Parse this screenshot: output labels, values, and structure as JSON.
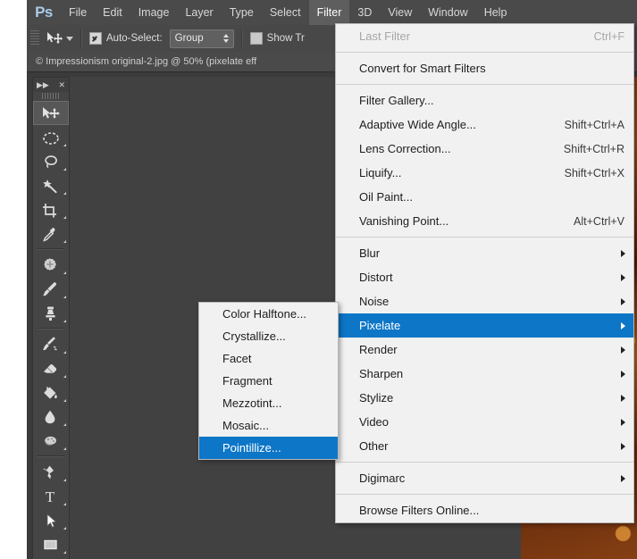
{
  "app": {
    "name": "Adobe Photoshop",
    "logo_text": "Ps"
  },
  "menubar": {
    "items": [
      {
        "label": "File",
        "active": false
      },
      {
        "label": "Edit",
        "active": false
      },
      {
        "label": "Image",
        "active": false
      },
      {
        "label": "Layer",
        "active": false
      },
      {
        "label": "Type",
        "active": false
      },
      {
        "label": "Select",
        "active": false
      },
      {
        "label": "Filter",
        "active": true
      },
      {
        "label": "3D",
        "active": false
      },
      {
        "label": "View",
        "active": false
      },
      {
        "label": "Window",
        "active": false
      },
      {
        "label": "Help",
        "active": false
      }
    ]
  },
  "options_bar": {
    "tool": "move-tool",
    "auto_select_label": "Auto-Select:",
    "auto_select_checked": true,
    "auto_select_value": "Group",
    "show_transform_label": "Show Tr",
    "show_transform_checked": false,
    "align_icon": "align-vertical-center-icon"
  },
  "document": {
    "tab_title": "© Impressionism original-2.jpg @ 50% (pixelate eff"
  },
  "toolbar": {
    "collapse_icon": "expand-arrows-icon",
    "close_icon": "close-icon",
    "tools": [
      {
        "name": "move-tool",
        "selected": true
      },
      {
        "name": "marquee-tool",
        "selected": false
      },
      {
        "name": "lasso-tool",
        "selected": false
      },
      {
        "name": "magic-wand-tool",
        "selected": false
      },
      {
        "name": "crop-tool",
        "selected": false
      },
      {
        "name": "eyedropper-tool",
        "selected": false
      },
      {
        "name": "spot-healing-brush-tool",
        "selected": false
      },
      {
        "name": "brush-tool",
        "selected": false
      },
      {
        "name": "clone-stamp-tool",
        "selected": false
      },
      {
        "name": "history-brush-tool",
        "selected": false
      },
      {
        "name": "eraser-tool",
        "selected": false
      },
      {
        "name": "paint-bucket-tool",
        "selected": false
      },
      {
        "name": "blur-tool",
        "selected": false
      },
      {
        "name": "dodge-tool",
        "selected": false
      },
      {
        "name": "pen-tool",
        "selected": false
      },
      {
        "name": "type-tool",
        "selected": false
      },
      {
        "name": "path-selection-tool",
        "selected": false
      },
      {
        "name": "rectangle-shape-tool",
        "selected": false
      }
    ]
  },
  "filter_menu": {
    "groups": [
      [
        {
          "label": "Last Filter",
          "shortcut": "Ctrl+F",
          "disabled": true,
          "submenu": false,
          "highlighted": false
        }
      ],
      [
        {
          "label": "Convert for Smart Filters",
          "shortcut": "",
          "disabled": false,
          "submenu": false,
          "highlighted": false
        }
      ],
      [
        {
          "label": "Filter Gallery...",
          "shortcut": "",
          "disabled": false,
          "submenu": false,
          "highlighted": false
        },
        {
          "label": "Adaptive Wide Angle...",
          "shortcut": "Shift+Ctrl+A",
          "disabled": false,
          "submenu": false,
          "highlighted": false
        },
        {
          "label": "Lens Correction...",
          "shortcut": "Shift+Ctrl+R",
          "disabled": false,
          "submenu": false,
          "highlighted": false
        },
        {
          "label": "Liquify...",
          "shortcut": "Shift+Ctrl+X",
          "disabled": false,
          "submenu": false,
          "highlighted": false
        },
        {
          "label": "Oil Paint...",
          "shortcut": "",
          "disabled": false,
          "submenu": false,
          "highlighted": false
        },
        {
          "label": "Vanishing Point...",
          "shortcut": "Alt+Ctrl+V",
          "disabled": false,
          "submenu": false,
          "highlighted": false
        }
      ],
      [
        {
          "label": "Blur",
          "shortcut": "",
          "disabled": false,
          "submenu": true,
          "highlighted": false
        },
        {
          "label": "Distort",
          "shortcut": "",
          "disabled": false,
          "submenu": true,
          "highlighted": false
        },
        {
          "label": "Noise",
          "shortcut": "",
          "disabled": false,
          "submenu": true,
          "highlighted": false
        },
        {
          "label": "Pixelate",
          "shortcut": "",
          "disabled": false,
          "submenu": true,
          "highlighted": true
        },
        {
          "label": "Render",
          "shortcut": "",
          "disabled": false,
          "submenu": true,
          "highlighted": false
        },
        {
          "label": "Sharpen",
          "shortcut": "",
          "disabled": false,
          "submenu": true,
          "highlighted": false
        },
        {
          "label": "Stylize",
          "shortcut": "",
          "disabled": false,
          "submenu": true,
          "highlighted": false
        },
        {
          "label": "Video",
          "shortcut": "",
          "disabled": false,
          "submenu": true,
          "highlighted": false
        },
        {
          "label": "Other",
          "shortcut": "",
          "disabled": false,
          "submenu": true,
          "highlighted": false
        }
      ],
      [
        {
          "label": "Digimarc",
          "shortcut": "",
          "disabled": false,
          "submenu": true,
          "highlighted": false
        }
      ],
      [
        {
          "label": "Browse Filters Online...",
          "shortcut": "",
          "disabled": false,
          "submenu": false,
          "highlighted": false
        }
      ]
    ]
  },
  "pixelate_submenu": {
    "items": [
      {
        "label": "Color Halftone...",
        "highlighted": false
      },
      {
        "label": "Crystallize...",
        "highlighted": false
      },
      {
        "label": "Facet",
        "highlighted": false
      },
      {
        "label": "Fragment",
        "highlighted": false
      },
      {
        "label": "Mezzotint...",
        "highlighted": false
      },
      {
        "label": "Mosaic...",
        "highlighted": false
      },
      {
        "label": "Pointillize...",
        "highlighted": true
      }
    ]
  },
  "colors": {
    "menu_highlight": "#0d76c7",
    "menu_background": "#f1f1f1",
    "chrome": "#4a4a4a",
    "canvas": "#414141",
    "logo": "#a9cbe8"
  }
}
